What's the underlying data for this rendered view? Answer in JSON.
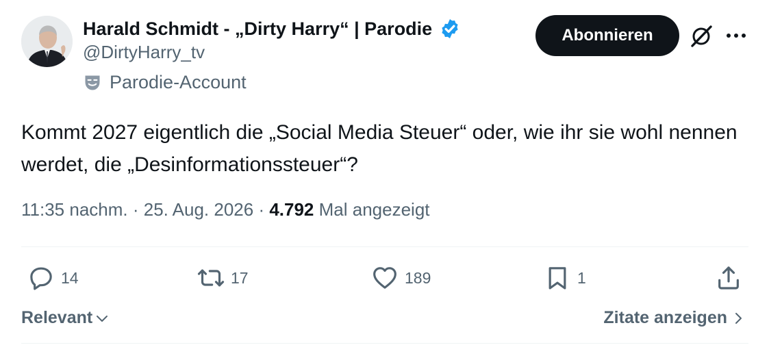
{
  "author": {
    "display_name": "Harald Schmidt - „Dirty Harry“ | Parodie",
    "handle": "@DirtyHarry_tv",
    "parody_label": "Parodie-Account",
    "verified_color": "#1d9bf0"
  },
  "header": {
    "follow_label": "Abonnieren",
    "grok_icon": "grok-icon",
    "more_icon": "more-icon"
  },
  "tweet": {
    "text": "Kommt 2027 eigentlich die „Social Media Steuer“ oder, wie ihr sie wohl nennen werdet, die „Desinformationssteuer“?"
  },
  "meta": {
    "time": "11:35 nachm.",
    "separator": " · ",
    "date": "25. Aug. 2026",
    "views_count": "4.792",
    "views_label": "Mal angezeigt"
  },
  "actions": {
    "replies": "14",
    "reposts": "17",
    "likes": "189",
    "bookmarks": "1"
  },
  "footer": {
    "sort_label": "Relevant",
    "quotes_label": "Zitate anzeigen"
  },
  "colors": {
    "text_primary": "#0f1419",
    "text_secondary": "#536471",
    "follow_bg": "#0f1419",
    "divider": "#eff3f4"
  }
}
